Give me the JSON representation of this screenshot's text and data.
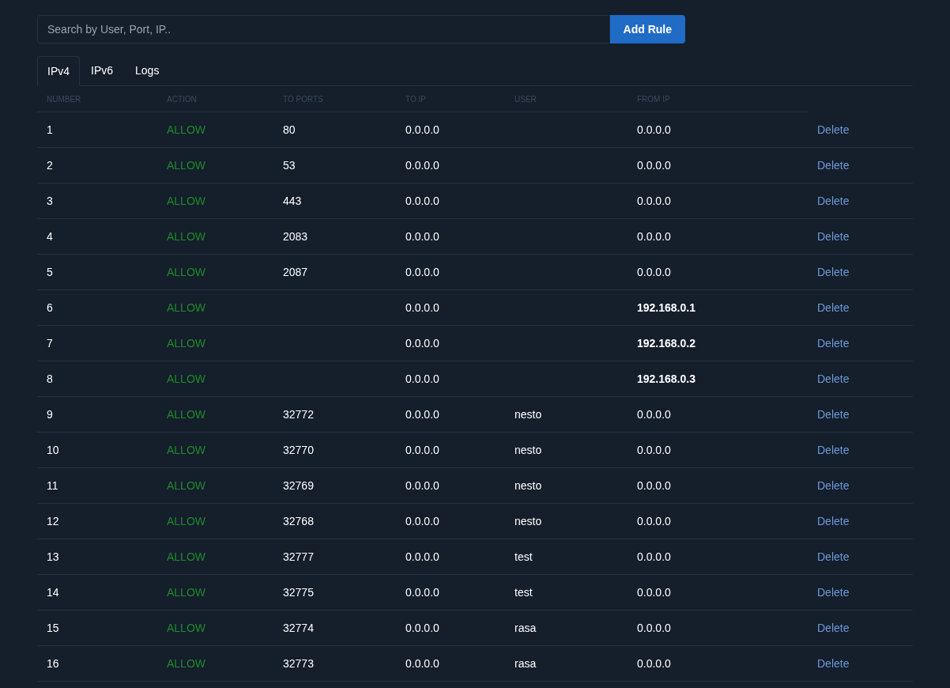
{
  "search": {
    "placeholder": "Search by User, Port, IP.."
  },
  "add_button": "Add Rule",
  "tabs": [
    {
      "label": "IPv4",
      "selected": true
    },
    {
      "label": "IPv6",
      "selected": false
    },
    {
      "label": "Logs",
      "selected": false
    }
  ],
  "table": {
    "columns": [
      "NUMBER",
      "ACTION",
      "TO PORTS",
      "TO IP",
      "USER",
      "FROM IP"
    ],
    "rows": [
      {
        "number": "1",
        "action": "ALLOW",
        "to_ports": "80",
        "to_ip": "0.0.0.0",
        "user": "",
        "from_ip": "0.0.0.0",
        "from_ip_bold": false,
        "delete": "Delete"
      },
      {
        "number": "2",
        "action": "ALLOW",
        "to_ports": "53",
        "to_ip": "0.0.0.0",
        "user": "",
        "from_ip": "0.0.0.0",
        "from_ip_bold": false,
        "delete": "Delete"
      },
      {
        "number": "3",
        "action": "ALLOW",
        "to_ports": "443",
        "to_ip": "0.0.0.0",
        "user": "",
        "from_ip": "0.0.0.0",
        "from_ip_bold": false,
        "delete": "Delete"
      },
      {
        "number": "4",
        "action": "ALLOW",
        "to_ports": "2083",
        "to_ip": "0.0.0.0",
        "user": "",
        "from_ip": "0.0.0.0",
        "from_ip_bold": false,
        "delete": "Delete"
      },
      {
        "number": "5",
        "action": "ALLOW",
        "to_ports": "2087",
        "to_ip": "0.0.0.0",
        "user": "",
        "from_ip": "0.0.0.0",
        "from_ip_bold": false,
        "delete": "Delete"
      },
      {
        "number": "6",
        "action": "ALLOW",
        "to_ports": "",
        "to_ip": "0.0.0.0",
        "user": "",
        "from_ip": "192.168.0.1",
        "from_ip_bold": true,
        "delete": "Delete"
      },
      {
        "number": "7",
        "action": "ALLOW",
        "to_ports": "",
        "to_ip": "0.0.0.0",
        "user": "",
        "from_ip": "192.168.0.2",
        "from_ip_bold": true,
        "delete": "Delete"
      },
      {
        "number": "8",
        "action": "ALLOW",
        "to_ports": "",
        "to_ip": "0.0.0.0",
        "user": "",
        "from_ip": "192.168.0.3",
        "from_ip_bold": true,
        "delete": "Delete"
      },
      {
        "number": "9",
        "action": "ALLOW",
        "to_ports": "32772",
        "to_ip": "0.0.0.0",
        "user": "nesto",
        "from_ip": "0.0.0.0",
        "from_ip_bold": false,
        "delete": "Delete"
      },
      {
        "number": "10",
        "action": "ALLOW",
        "to_ports": "32770",
        "to_ip": "0.0.0.0",
        "user": "nesto",
        "from_ip": "0.0.0.0",
        "from_ip_bold": false,
        "delete": "Delete"
      },
      {
        "number": "11",
        "action": "ALLOW",
        "to_ports": "32769",
        "to_ip": "0.0.0.0",
        "user": "nesto",
        "from_ip": "0.0.0.0",
        "from_ip_bold": false,
        "delete": "Delete"
      },
      {
        "number": "12",
        "action": "ALLOW",
        "to_ports": "32768",
        "to_ip": "0.0.0.0",
        "user": "nesto",
        "from_ip": "0.0.0.0",
        "from_ip_bold": false,
        "delete": "Delete"
      },
      {
        "number": "13",
        "action": "ALLOW",
        "to_ports": "32777",
        "to_ip": "0.0.0.0",
        "user": "test",
        "from_ip": "0.0.0.0",
        "from_ip_bold": false,
        "delete": "Delete"
      },
      {
        "number": "14",
        "action": "ALLOW",
        "to_ports": "32775",
        "to_ip": "0.0.0.0",
        "user": "test",
        "from_ip": "0.0.0.0",
        "from_ip_bold": false,
        "delete": "Delete"
      },
      {
        "number": "15",
        "action": "ALLOW",
        "to_ports": "32774",
        "to_ip": "0.0.0.0",
        "user": "rasa",
        "from_ip": "0.0.0.0",
        "from_ip_bold": false,
        "delete": "Delete"
      },
      {
        "number": "16",
        "action": "ALLOW",
        "to_ports": "32773",
        "to_ip": "0.0.0.0",
        "user": "rasa",
        "from_ip": "0.0.0.0",
        "from_ip_bold": false,
        "delete": "Delete"
      }
    ]
  }
}
